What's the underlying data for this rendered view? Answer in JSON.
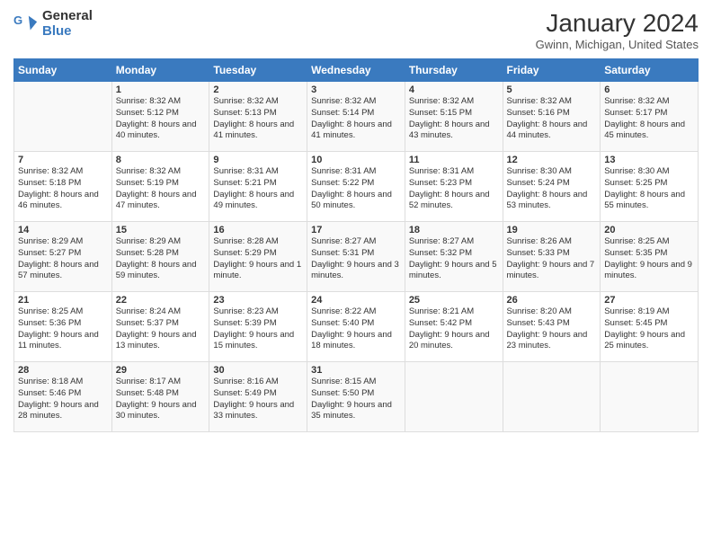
{
  "logo": {
    "line1": "General",
    "line2": "Blue"
  },
  "title": "January 2024",
  "subtitle": "Gwinn, Michigan, United States",
  "days_of_week": [
    "Sunday",
    "Monday",
    "Tuesday",
    "Wednesday",
    "Thursday",
    "Friday",
    "Saturday"
  ],
  "weeks": [
    [
      {
        "day": "",
        "sunrise": "",
        "sunset": "",
        "daylight": ""
      },
      {
        "day": "1",
        "sunrise": "Sunrise: 8:32 AM",
        "sunset": "Sunset: 5:12 PM",
        "daylight": "Daylight: 8 hours and 40 minutes."
      },
      {
        "day": "2",
        "sunrise": "Sunrise: 8:32 AM",
        "sunset": "Sunset: 5:13 PM",
        "daylight": "Daylight: 8 hours and 41 minutes."
      },
      {
        "day": "3",
        "sunrise": "Sunrise: 8:32 AM",
        "sunset": "Sunset: 5:14 PM",
        "daylight": "Daylight: 8 hours and 41 minutes."
      },
      {
        "day": "4",
        "sunrise": "Sunrise: 8:32 AM",
        "sunset": "Sunset: 5:15 PM",
        "daylight": "Daylight: 8 hours and 43 minutes."
      },
      {
        "day": "5",
        "sunrise": "Sunrise: 8:32 AM",
        "sunset": "Sunset: 5:16 PM",
        "daylight": "Daylight: 8 hours and 44 minutes."
      },
      {
        "day": "6",
        "sunrise": "Sunrise: 8:32 AM",
        "sunset": "Sunset: 5:17 PM",
        "daylight": "Daylight: 8 hours and 45 minutes."
      }
    ],
    [
      {
        "day": "7",
        "sunrise": "Sunrise: 8:32 AM",
        "sunset": "Sunset: 5:18 PM",
        "daylight": "Daylight: 8 hours and 46 minutes."
      },
      {
        "day": "8",
        "sunrise": "Sunrise: 8:32 AM",
        "sunset": "Sunset: 5:19 PM",
        "daylight": "Daylight: 8 hours and 47 minutes."
      },
      {
        "day": "9",
        "sunrise": "Sunrise: 8:31 AM",
        "sunset": "Sunset: 5:21 PM",
        "daylight": "Daylight: 8 hours and 49 minutes."
      },
      {
        "day": "10",
        "sunrise": "Sunrise: 8:31 AM",
        "sunset": "Sunset: 5:22 PM",
        "daylight": "Daylight: 8 hours and 50 minutes."
      },
      {
        "day": "11",
        "sunrise": "Sunrise: 8:31 AM",
        "sunset": "Sunset: 5:23 PM",
        "daylight": "Daylight: 8 hours and 52 minutes."
      },
      {
        "day": "12",
        "sunrise": "Sunrise: 8:30 AM",
        "sunset": "Sunset: 5:24 PM",
        "daylight": "Daylight: 8 hours and 53 minutes."
      },
      {
        "day": "13",
        "sunrise": "Sunrise: 8:30 AM",
        "sunset": "Sunset: 5:25 PM",
        "daylight": "Daylight: 8 hours and 55 minutes."
      }
    ],
    [
      {
        "day": "14",
        "sunrise": "Sunrise: 8:29 AM",
        "sunset": "Sunset: 5:27 PM",
        "daylight": "Daylight: 8 hours and 57 minutes."
      },
      {
        "day": "15",
        "sunrise": "Sunrise: 8:29 AM",
        "sunset": "Sunset: 5:28 PM",
        "daylight": "Daylight: 8 hours and 59 minutes."
      },
      {
        "day": "16",
        "sunrise": "Sunrise: 8:28 AM",
        "sunset": "Sunset: 5:29 PM",
        "daylight": "Daylight: 9 hours and 1 minute."
      },
      {
        "day": "17",
        "sunrise": "Sunrise: 8:27 AM",
        "sunset": "Sunset: 5:31 PM",
        "daylight": "Daylight: 9 hours and 3 minutes."
      },
      {
        "day": "18",
        "sunrise": "Sunrise: 8:27 AM",
        "sunset": "Sunset: 5:32 PM",
        "daylight": "Daylight: 9 hours and 5 minutes."
      },
      {
        "day": "19",
        "sunrise": "Sunrise: 8:26 AM",
        "sunset": "Sunset: 5:33 PM",
        "daylight": "Daylight: 9 hours and 7 minutes."
      },
      {
        "day": "20",
        "sunrise": "Sunrise: 8:25 AM",
        "sunset": "Sunset: 5:35 PM",
        "daylight": "Daylight: 9 hours and 9 minutes."
      }
    ],
    [
      {
        "day": "21",
        "sunrise": "Sunrise: 8:25 AM",
        "sunset": "Sunset: 5:36 PM",
        "daylight": "Daylight: 9 hours and 11 minutes."
      },
      {
        "day": "22",
        "sunrise": "Sunrise: 8:24 AM",
        "sunset": "Sunset: 5:37 PM",
        "daylight": "Daylight: 9 hours and 13 minutes."
      },
      {
        "day": "23",
        "sunrise": "Sunrise: 8:23 AM",
        "sunset": "Sunset: 5:39 PM",
        "daylight": "Daylight: 9 hours and 15 minutes."
      },
      {
        "day": "24",
        "sunrise": "Sunrise: 8:22 AM",
        "sunset": "Sunset: 5:40 PM",
        "daylight": "Daylight: 9 hours and 18 minutes."
      },
      {
        "day": "25",
        "sunrise": "Sunrise: 8:21 AM",
        "sunset": "Sunset: 5:42 PM",
        "daylight": "Daylight: 9 hours and 20 minutes."
      },
      {
        "day": "26",
        "sunrise": "Sunrise: 8:20 AM",
        "sunset": "Sunset: 5:43 PM",
        "daylight": "Daylight: 9 hours and 23 minutes."
      },
      {
        "day": "27",
        "sunrise": "Sunrise: 8:19 AM",
        "sunset": "Sunset: 5:45 PM",
        "daylight": "Daylight: 9 hours and 25 minutes."
      }
    ],
    [
      {
        "day": "28",
        "sunrise": "Sunrise: 8:18 AM",
        "sunset": "Sunset: 5:46 PM",
        "daylight": "Daylight: 9 hours and 28 minutes."
      },
      {
        "day": "29",
        "sunrise": "Sunrise: 8:17 AM",
        "sunset": "Sunset: 5:48 PM",
        "daylight": "Daylight: 9 hours and 30 minutes."
      },
      {
        "day": "30",
        "sunrise": "Sunrise: 8:16 AM",
        "sunset": "Sunset: 5:49 PM",
        "daylight": "Daylight: 9 hours and 33 minutes."
      },
      {
        "day": "31",
        "sunrise": "Sunrise: 8:15 AM",
        "sunset": "Sunset: 5:50 PM",
        "daylight": "Daylight: 9 hours and 35 minutes."
      },
      {
        "day": "",
        "sunrise": "",
        "sunset": "",
        "daylight": ""
      },
      {
        "day": "",
        "sunrise": "",
        "sunset": "",
        "daylight": ""
      },
      {
        "day": "",
        "sunrise": "",
        "sunset": "",
        "daylight": ""
      }
    ]
  ]
}
